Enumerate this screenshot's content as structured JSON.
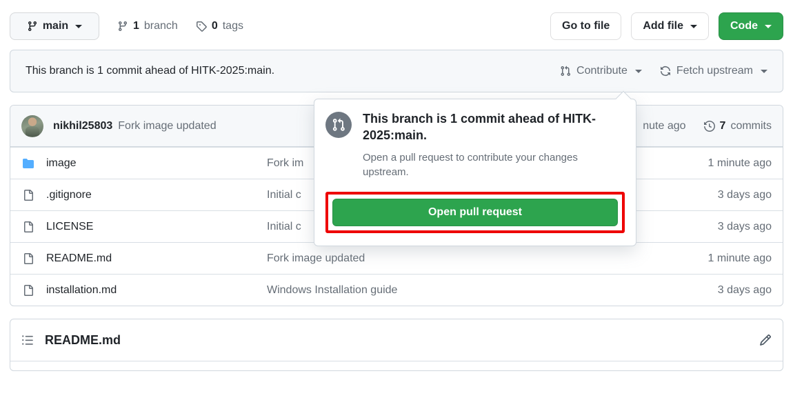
{
  "toolbar": {
    "branch_selector": {
      "label": "main",
      "icon": "branch-icon"
    },
    "branches": {
      "count": "1",
      "label": "branch",
      "icon": "branch-icon"
    },
    "tags": {
      "count": "0",
      "label": "tags",
      "icon": "tag-icon"
    },
    "go_to_file": "Go to file",
    "add_file": "Add file",
    "code": "Code"
  },
  "notice": {
    "text": "This branch is 1 commit ahead of HITK-2025:main.",
    "contribute": "Contribute",
    "fetch_upstream": "Fetch upstream"
  },
  "commit_header": {
    "author": "nikhil25803",
    "message": "Fork image updated",
    "time": "nute ago",
    "commits_count": "7",
    "commits_label": "commits"
  },
  "files": [
    {
      "icon": "folder-icon",
      "name": "image",
      "message": "Fork im",
      "time": "1 minute ago"
    },
    {
      "icon": "file-icon",
      "name": ".gitignore",
      "message": "Initial c",
      "time": "3 days ago"
    },
    {
      "icon": "file-icon",
      "name": "LICENSE",
      "message": "Initial c",
      "time": "3 days ago"
    },
    {
      "icon": "file-icon",
      "name": "README.md",
      "message": "Fork image updated",
      "time": "1 minute ago"
    },
    {
      "icon": "file-icon",
      "name": "installation.md",
      "message": "Windows Installation guide",
      "time": "3 days ago"
    }
  ],
  "readme": {
    "title": "README.md",
    "list_icon": "list-unordered-icon",
    "edit_icon": "pencil-icon"
  },
  "popup": {
    "badge_icon": "git-pull-request-icon",
    "heading": "This branch is 1 commit ahead of HITK-2025:main.",
    "subtext": "Open a pull request to contribute your changes upstream.",
    "button": "Open pull request"
  },
  "colors": {
    "green": "#2da44e",
    "highlight_red": "#ee0000",
    "folder_blue": "#54aeff",
    "muted": "#656d76",
    "border": "#d0d7de"
  }
}
